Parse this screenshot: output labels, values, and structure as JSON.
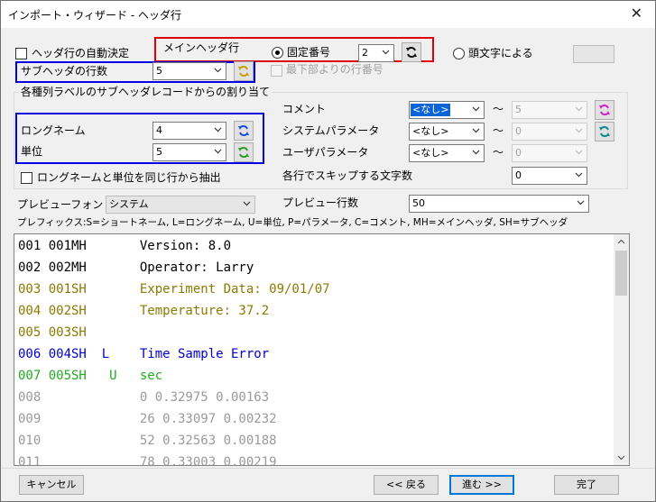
{
  "window": {
    "title": "インポート・ウィザード - ヘッダ行",
    "close_symbol": "✕"
  },
  "top": {
    "auto_header_label": "ヘッダ行の自動決定",
    "main_header_label": "メインヘッダ行",
    "fixed_number_label": "固定番号",
    "main_header_value": "2",
    "first_char_label": "頭文字による",
    "first_char_value": "",
    "from_bottom_label": "最下部よりの行番号",
    "subheader_count_label": "サブヘッダの行数",
    "subheader_count_value": "5"
  },
  "assignment": {
    "group_label": "各種列ラベルのサブヘッダレコードからの割り当て",
    "longname_label": "ロングネーム",
    "longname_value": "4",
    "unit_label": "単位",
    "unit_value": "5",
    "same_row_label": "ロングネームと単位を同じ行から抽出",
    "comment_label": "コメント",
    "comment_value": "<なし>",
    "comment_to": "5",
    "sysparam_label": "システムパラメータ",
    "sysparam_value": "<なし>",
    "sysparam_to": "0",
    "userparam_label": "ユーザパラメータ",
    "userparam_value": "<なし>",
    "userparam_to": "0",
    "tilde": "〜",
    "skip_label": "各行でスキップする文字数",
    "skip_value": "0"
  },
  "preview_opts": {
    "font_label": "プレビューフォント",
    "font_value": "システム",
    "lines_label": "プレビュー行数",
    "lines_value": "50",
    "prefix_note": "プレフィックス:S=ショートネーム, L=ロングネーム, U=単位, P=パラメータ, C=コメント, MH=メインヘッダ, SH=サブヘッダ"
  },
  "preview_lines": [
    {
      "text": "001 001MH       Version: 8.0",
      "color": "#000000"
    },
    {
      "text": "002 002MH       Operator: Larry",
      "color": "#000000"
    },
    {
      "text": "003 001SH       Experiment Data: 09/01/07",
      "color": "#8a7a00"
    },
    {
      "text": "004 002SH       Temperature: 37.2",
      "color": "#8a7a00"
    },
    {
      "text": "005 003SH",
      "color": "#8a7a00"
    },
    {
      "text": "006 004SH  L    Time Sample Error",
      "color": "#0000cc"
    },
    {
      "text": "007 005SH   U   sec",
      "color": "#22aa22"
    },
    {
      "text": "008             0 0.32975 0.00163",
      "color": "#9a9a9a"
    },
    {
      "text": "009             26 0.33097 0.00232",
      "color": "#9a9a9a"
    },
    {
      "text": "010             52 0.32563 0.00188",
      "color": "#9a9a9a"
    },
    {
      "text": "011             78 0.33003 0.00219",
      "color": "#9a9a9a"
    }
  ],
  "buttons": {
    "cancel": "キャンセル",
    "back": "<< 戻る",
    "next": "進む >>",
    "finish": "完了"
  },
  "colors": {
    "highlight_red": "#e00000",
    "highlight_blue": "#0000e0",
    "selected": "#0a64d8"
  }
}
